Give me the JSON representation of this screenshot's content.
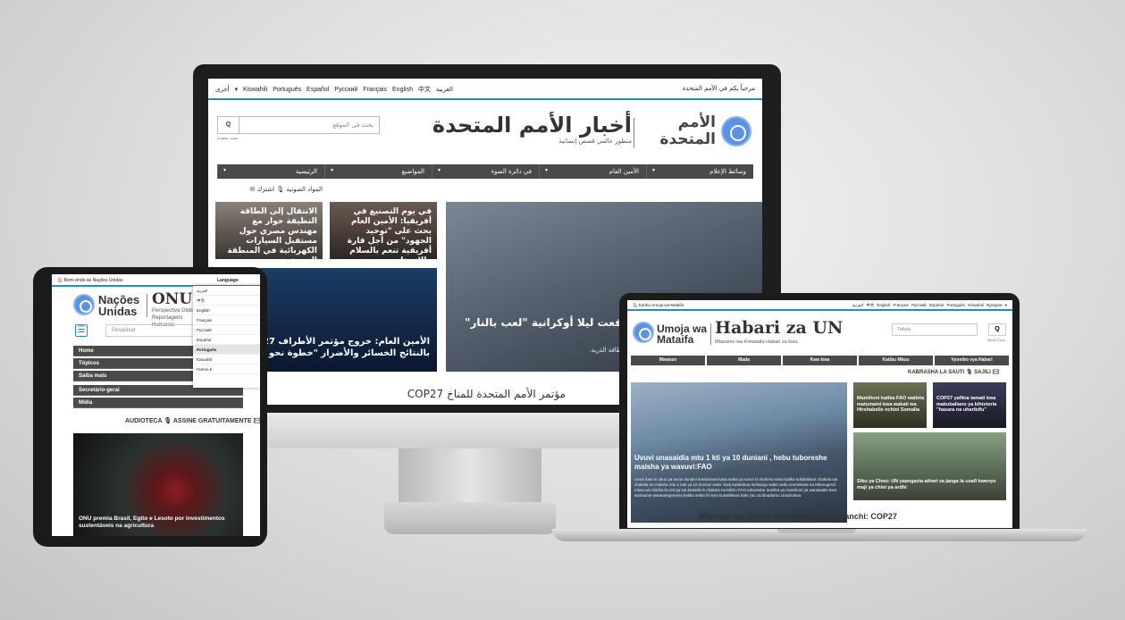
{
  "desktop": {
    "welcome": "مرحباً بكم في الأمم المتحدة",
    "languages": "أخرى ▾  Kiswahili  Português  Español  Русский  Français  English  中文  العربية",
    "un_logo": "الأمم المتحدة",
    "title": "أخبار الأمم المتحدة",
    "subtitle": "منظور عالمي قصص إنسانية",
    "search_placeholder": "بحث في الموقع",
    "search_button": "Q",
    "advanced_search": "بحث متقدم",
    "nav": [
      "الرئيسية",
      "المواضيع",
      "في دائرة الضوء",
      "الأمين العام",
      "وسائط الإعلام"
    ],
    "subscribe_bar": "المواد الصوتية 🎙  اشترك ✉",
    "hero_caption": "الذرية: الانفجارات التي وقعت ليلا أوكرانية \"لعب بالنار\"",
    "hero_sub": "زابوروجيا الأوكرانية. \"منهية بشكل مفاجئ فترة من طاقة الذرية.",
    "card1": "في يوم التصنيع في أفريقيا: الأمين العام يحث على \"توحيد الجهود\" من أجل قارة أفريقية تنعم بالسلام والازدهار",
    "card2": "الانتقال إلى الطاقة النظيفة حوار مع مهندس مصري حول مستقبل السيارات الكهربائية في المنطقة العربية",
    "card3": "الأمين العام: خروج مؤتمر الأطراف COP27 بالنتائج الخسائر والأضرار \"خطوة نحو العدالة\"",
    "bottom_heading": "مؤتمر الأمم المتحدة للمناخ COP27"
  },
  "tablet": {
    "welcome": "🏠 Bem-vindo às Nações Unidas",
    "language_label": "Language",
    "logo": "Nações Unidas",
    "title": "ONU News",
    "subtitle": "Perspectiva Global Reportagens Humanas",
    "search_placeholder": "Pesquisar",
    "menu_icon": "☰",
    "nav": [
      "Home",
      "Tópicos",
      "Saiba mais",
      "Secretário-geral",
      "Mídia"
    ],
    "language_options": [
      "العربية",
      "中文",
      "English",
      "Français",
      "Русский",
      "Español",
      "Português",
      "Kiswahili",
      "Outros ▾"
    ],
    "audio_bar": "AUDIOTECA 🎙  ASSINE GRATUITAMENTE ✉",
    "hero_caption": "ONU premia Brasil, Egito e Lesoto por investimentos sustentáveis na agricultura"
  },
  "laptop": {
    "welcome": "🏠 Karibu Umoja wa Mataifa",
    "languages": "العربية  中文  English  Français  Русский  Español  Português  Kiswahili  Nyingine ▾",
    "logo": "Umoja wa Mataifa",
    "title": "Habari za UN",
    "subtitle": "Mtazamo wa Kimataifa Habari za kutu",
    "search_placeholder": "Tafuta",
    "search_button": "Q",
    "advanced_search": "Tafuta Zaidi",
    "nav": [
      "Mwanzo",
      "Mada",
      "Kwa kina",
      "Katibu Mkuu",
      "Vyombo vya Habari"
    ],
    "audio_bar": "KABRASHA LA SAUTI 🎙  SAJILI ✉",
    "hero_caption": "Uvuvi unasaidia mtu 1 kti ya 10 duniani , hebu tuboreshe maisha ya wavuvi:FAO",
    "hero_body": "Uvuvi kwa ni ukuu ya uvuvi duniani imesiezwa kuwa sekta ya uvuvi ni muhimu sana katika kukabiliana chakula wa chakula na maisha mtu 1 kati ya 10 duniani wote. Kwa kutambua mchango wake wafo umetolewa na Mkurugenzi mkuu wa shirika la Umoja wa Mataifa la chakula na kilimo FAO tuboreshe maisha ya mamilioni ya wanawake kwa wanaume wanaotegemeza katika sekta hii kwa kukabiliana haki zao za binadamu zinazindwa.",
    "card1": "Mamilioni katika FAO walieta matumaini kwa wakati wa Hirshabelle nchini Somalia",
    "card2": "COP27 yafikia tamati kwa makubaliano ya kihistoria \"hasara na uharibifu\"",
    "card3": "Siku ya Choo: UN yaangazia athari za janga la usafi kwenye maji ya chini ya ardhi",
    "bottom_heading": "Mkutano wa UN wa Mabadiliko ya Tabianchi: COP27"
  }
}
